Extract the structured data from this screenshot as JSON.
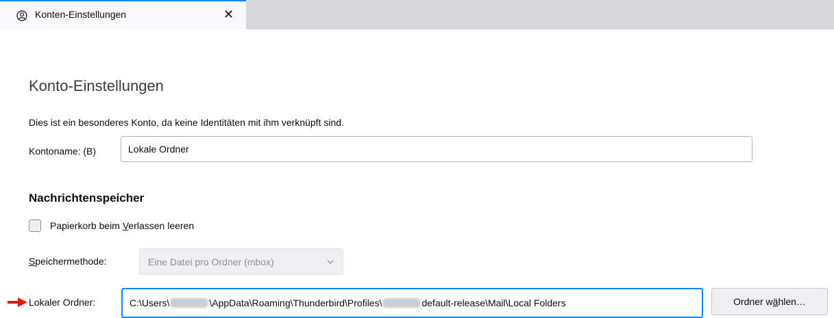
{
  "tab": {
    "icon": "account-settings-icon",
    "title": "Konten-Einstellungen",
    "close_glyph": "✕"
  },
  "page": {
    "title": "Konto-Einstellungen",
    "description": "Dies ist ein besonderes Konto, da keine Identitäten mit ihm verknüpft sind."
  },
  "account_name": {
    "label": "Kontoname: (B)",
    "value": "Lokale Ordner"
  },
  "message_storage": {
    "title": "Nachrichtenspeicher",
    "empty_trash": {
      "label_before": "Papierkorb beim ",
      "label_accesskey": "V",
      "label_after": "erlassen leeren",
      "checked": false
    },
    "storage_method": {
      "label_accesskey": "S",
      "label_rest": "peichermethode:",
      "selected": "Eine Datei pro Ordner (mbox)",
      "disabled": true
    },
    "local_folder": {
      "label": "Lokaler Ordner:",
      "path_part1": "C:\\Users\\",
      "path_part2": "\\AppData\\Roaming\\Thunderbird\\Profiles\\",
      "path_part3": "default-release\\Mail\\Local Folders",
      "button_before": "Ordner w",
      "button_accesskey": "ä",
      "button_after": "hlen…"
    }
  },
  "colors": {
    "accent": "#0a84ff",
    "annotation_arrow": "#e8170e"
  }
}
